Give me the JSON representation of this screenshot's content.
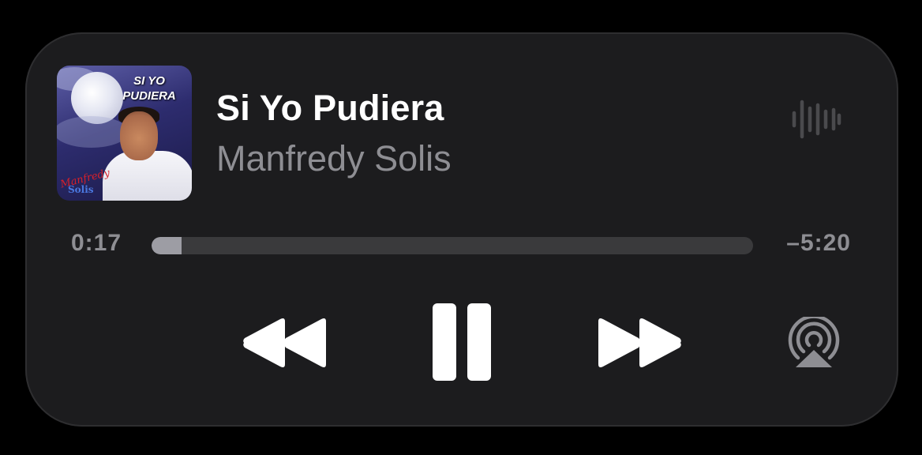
{
  "now_playing": {
    "artwork": {
      "title_line1": "SI YO",
      "title_line2": "PUDIERA",
      "signature_line1": "Manfredy",
      "signature_line2": "Solis"
    },
    "title": "Si Yo Pudiera",
    "artist": "Manfredy Solis",
    "elapsed": "0:17",
    "remaining": "–5:20",
    "progress_fraction": 0.05
  },
  "controls": {
    "rewind_icon": "rewind-icon",
    "pause_icon": "pause-icon",
    "forward_icon": "fast-forward-icon",
    "airplay_icon": "airplay-audio-icon",
    "waveform_icon": "waveform-icon"
  },
  "colors": {
    "background": "#000000",
    "panel": "#1c1c1e",
    "primary_text": "#ffffff",
    "secondary_text": "#8e8e93",
    "track": "#3a3a3c",
    "track_fill": "#9d9da4"
  }
}
